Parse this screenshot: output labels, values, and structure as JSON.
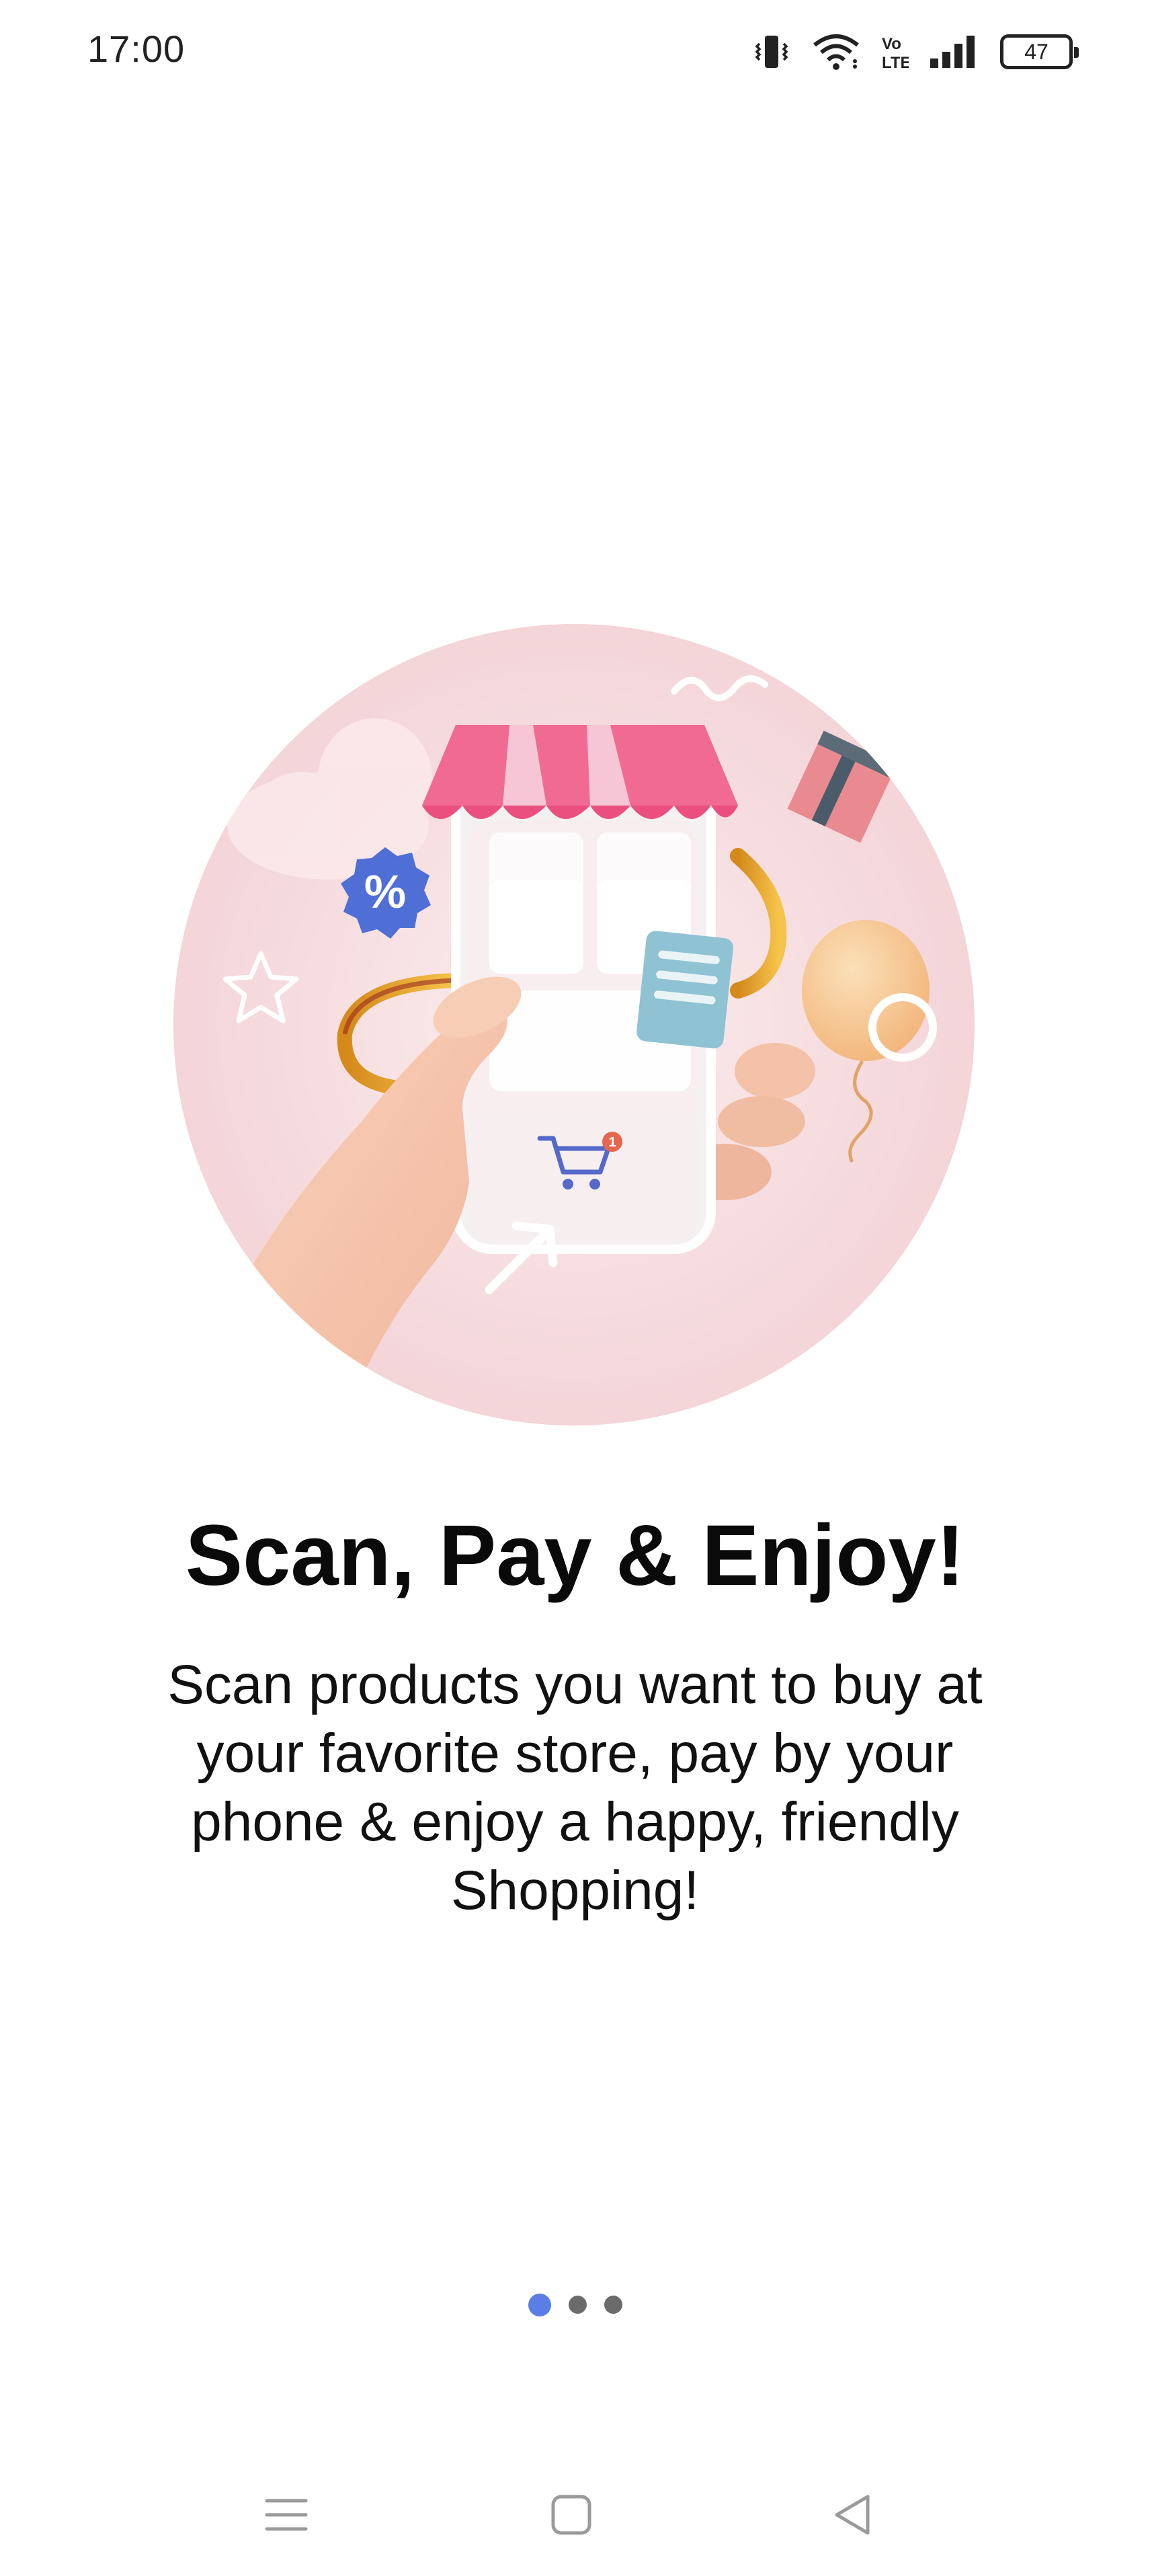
{
  "status_bar": {
    "time": "17:00",
    "battery_level": "47",
    "icons": [
      "vibrate-icon",
      "wifi-icon",
      "volte-icon",
      "signal-icon",
      "battery-icon"
    ]
  },
  "onboarding": {
    "title": "Scan, Pay & Enjoy!",
    "description": "Scan products you want to buy at your favorite store, pay by your phone & enjoy a happy, friendly Shopping!",
    "illustration": "shopping-phone-illustration",
    "page_indicator": {
      "total": 3,
      "current": 1
    }
  },
  "colors": {
    "accent": "#5b7ee5",
    "dot_inactive": "#6b6b6b",
    "awning_pink": "#f06a92",
    "circle_bg": "#f7dfe0"
  },
  "nav_bar": {
    "icons": [
      "menu-icon",
      "home-icon",
      "back-icon"
    ]
  }
}
